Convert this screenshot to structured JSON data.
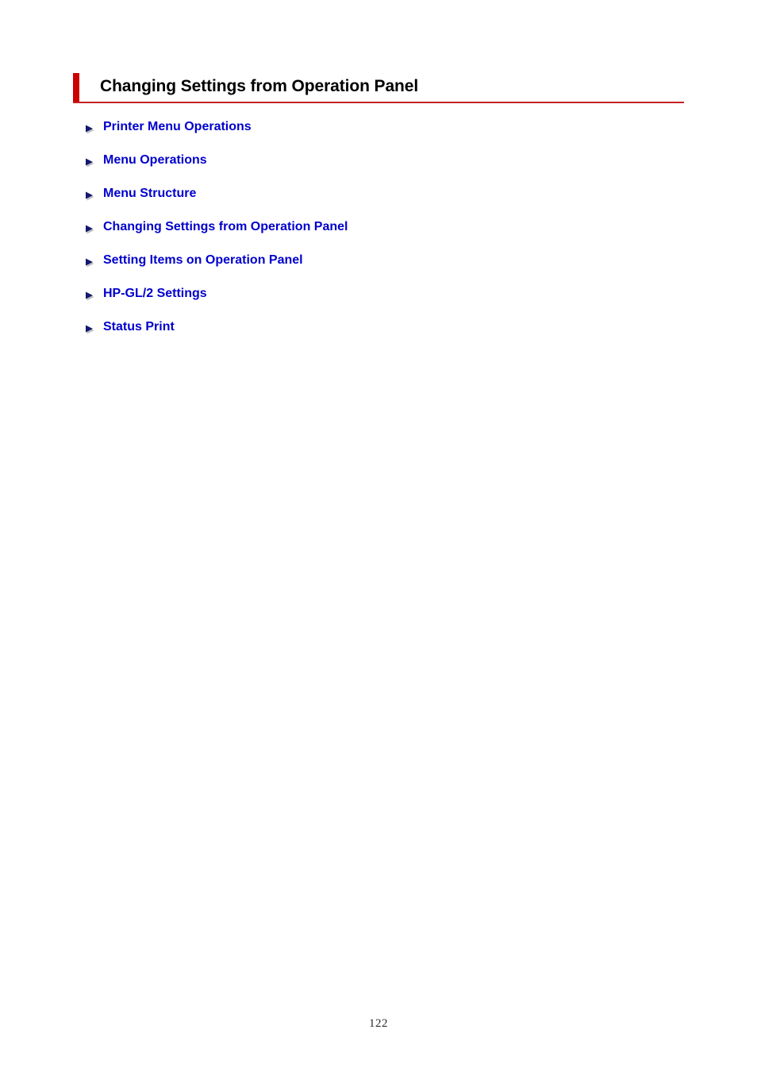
{
  "document": {
    "page_title": "Changing Settings from Operation Panel",
    "page_number": "122",
    "accent_color": "#CC0000",
    "rule_color": "#C42126",
    "link_color": "#0000CC",
    "title_color": "#000000",
    "background_color": "#FFFFFF"
  },
  "toc": {
    "bullet_icon": "right-triangle-arrow-icon",
    "items": [
      {
        "label": "Printer Menu Operations"
      },
      {
        "label": "Menu Operations"
      },
      {
        "label": "Menu Structure"
      },
      {
        "label": "Changing Settings from Operation Panel"
      },
      {
        "label": "Setting Items on Operation Panel"
      },
      {
        "label": "HP-GL/2 Settings"
      },
      {
        "label": "Status Print"
      }
    ]
  }
}
